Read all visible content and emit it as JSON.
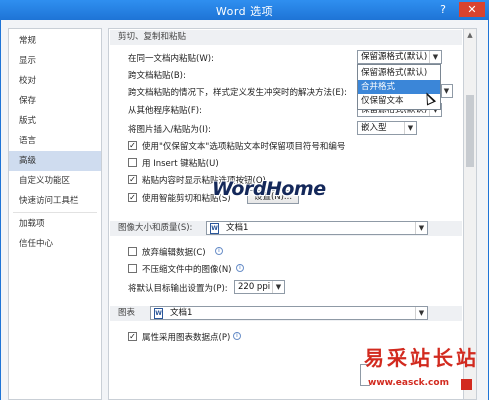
{
  "window": {
    "title": "Word 选项",
    "help_label": "?",
    "close_label": "✕"
  },
  "sidebar": {
    "items": [
      {
        "label": "常规"
      },
      {
        "label": "显示"
      },
      {
        "label": "校对"
      },
      {
        "label": "保存"
      },
      {
        "label": "版式"
      },
      {
        "label": "语言"
      },
      {
        "label": "高级",
        "active": true
      },
      {
        "label": "自定义功能区"
      },
      {
        "label": "快速访问工具栏"
      },
      {
        "label": "加载项"
      },
      {
        "label": "信任中心"
      }
    ]
  },
  "sections": {
    "cut_copy_paste": {
      "header": "剪切、复制和粘贴",
      "rows": {
        "same_doc": {
          "label": "在同一文档内粘贴(W):",
          "value": "保留源格式(默认)"
        },
        "cross_doc": {
          "label": "跨文档粘贴(B):"
        },
        "style_conflict": {
          "label": "跨文档粘贴的情况下，样式定义发生冲突时的解决方法(E):"
        },
        "other_programs": {
          "label": "从其他程序粘贴(F):",
          "value": "保留源格式(默认)"
        },
        "picture_mode": {
          "label": "将图片插入/粘贴为(I):",
          "value": "嵌入型"
        }
      },
      "checkboxes": [
        {
          "label": "使用\"仅保留文本\"选项粘贴文本时保留项目符号和编号",
          "checked": true
        },
        {
          "label": "用 Insert 键粘贴(U)",
          "checked": false
        },
        {
          "label": "粘贴内容时显示粘贴选项按钮(O)",
          "checked": true
        },
        {
          "label": "使用智能剪切和粘贴(S)",
          "checked": true
        }
      ],
      "settings_button": "设置(N)...",
      "dropdown_options": [
        {
          "label": "保留源格式(默认)",
          "highlighted": false
        },
        {
          "label": "合并格式",
          "highlighted": true
        },
        {
          "label": "仅保留文本",
          "highlighted": false
        }
      ]
    },
    "image_quality": {
      "header": "图像大小和质量(S):",
      "doc_value": "文档1",
      "checkboxes": [
        {
          "label": "放弃编辑数据(C)",
          "checked": false
        },
        {
          "label": "不压缩文件中的图像(N)",
          "checked": false
        }
      ],
      "resolution_label": "将默认目标输出设置为(P):",
      "resolution_value": "220 ppi"
    },
    "chart": {
      "header": "图表",
      "doc_value": "文档1",
      "checkboxes": [
        {
          "label": "属性采用图表数据点(P)",
          "checked": true
        }
      ]
    }
  },
  "watermark": {
    "logo_text": "WordHome",
    "brand_text": "易采站长站",
    "brand_url": "www.easck.com"
  },
  "colors": {
    "titlebar": "#1e74d6",
    "selection": "#3b86d8",
    "sidebar_active": "#cfdcef",
    "watermark_red": "#d22a1f"
  },
  "icons": {
    "dropdown": "chevron-down-icon",
    "doc": "word-document-icon",
    "info": "info-icon",
    "cursor": "mouse-pointer-icon"
  }
}
